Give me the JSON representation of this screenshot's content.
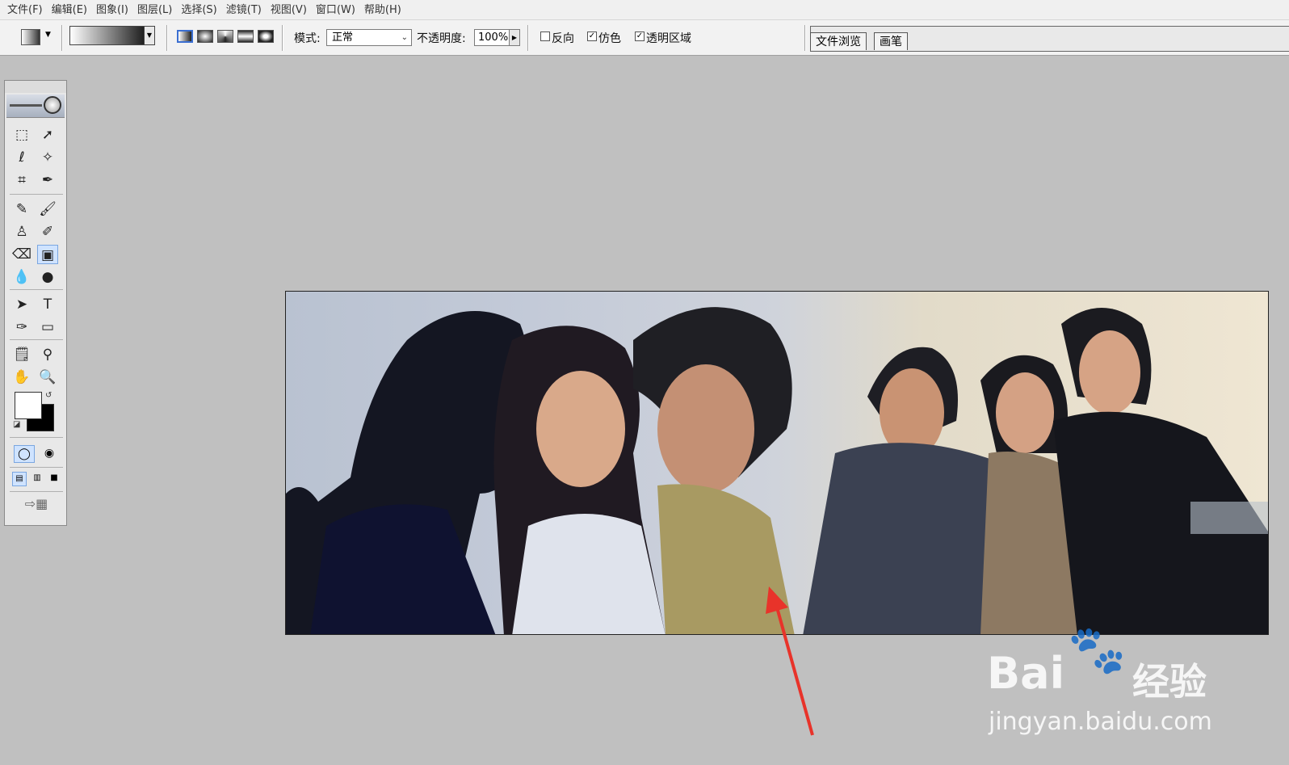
{
  "menu": [
    "文件(F)",
    "编辑(E)",
    "图象(I)",
    "图层(L)",
    "选择(S)",
    "滤镜(T)",
    "视图(V)",
    "窗口(W)",
    "帮助(H)"
  ],
  "options": {
    "mode_label": "模式:",
    "mode_value": "正常",
    "opacity_label": "不透明度:",
    "opacity_value": "100%",
    "reverse_label": "反向",
    "dither_label": "仿色",
    "transparency_label": "透明区域",
    "reverse_checked": false,
    "dither_checked": true,
    "transparency_checked": true
  },
  "palette_tabs": [
    "文件浏览",
    "画笔"
  ],
  "toolbox": {
    "tools": [
      {
        "name": "marquee-tool-icon",
        "glyph": "⬚"
      },
      {
        "name": "move-tool-icon",
        "glyph": "➚"
      },
      {
        "name": "lasso-tool-icon",
        "glyph": "ℓ"
      },
      {
        "name": "magic-wand-tool-icon",
        "glyph": "✧"
      },
      {
        "name": "crop-tool-icon",
        "glyph": "⌗"
      },
      {
        "name": "slice-tool-icon",
        "glyph": "✒"
      },
      {
        "name": "healing-brush-tool-icon",
        "glyph": "✎"
      },
      {
        "name": "brush-tool-icon",
        "glyph": "🖌"
      },
      {
        "name": "clone-stamp-tool-icon",
        "glyph": "♙"
      },
      {
        "name": "history-brush-tool-icon",
        "glyph": "✐"
      },
      {
        "name": "eraser-tool-icon",
        "glyph": "⌫"
      },
      {
        "name": "gradient-tool-icon",
        "glyph": "▣"
      },
      {
        "name": "blur-tool-icon",
        "glyph": "💧"
      },
      {
        "name": "dodge-tool-icon",
        "glyph": "●"
      },
      {
        "name": "path-selection-tool-icon",
        "glyph": "➤"
      },
      {
        "name": "type-tool-icon",
        "glyph": "T"
      },
      {
        "name": "pen-tool-icon",
        "glyph": "✑"
      },
      {
        "name": "shape-tool-icon",
        "glyph": "▭"
      },
      {
        "name": "notes-tool-icon",
        "glyph": "🗒"
      },
      {
        "name": "eyedropper-tool-icon",
        "glyph": "⚲"
      },
      {
        "name": "hand-tool-icon",
        "glyph": "✋"
      },
      {
        "name": "zoom-tool-icon",
        "glyph": "🔍"
      }
    ],
    "selected_tool": "gradient-tool-icon"
  },
  "colors": {
    "foreground": "#ffffff",
    "background": "#000000",
    "annotation_arrow": "#e8332a"
  },
  "watermark": {
    "logo_text": "Bai",
    "logo_suffix": "经验",
    "url": "jingyan.baidu.com"
  }
}
